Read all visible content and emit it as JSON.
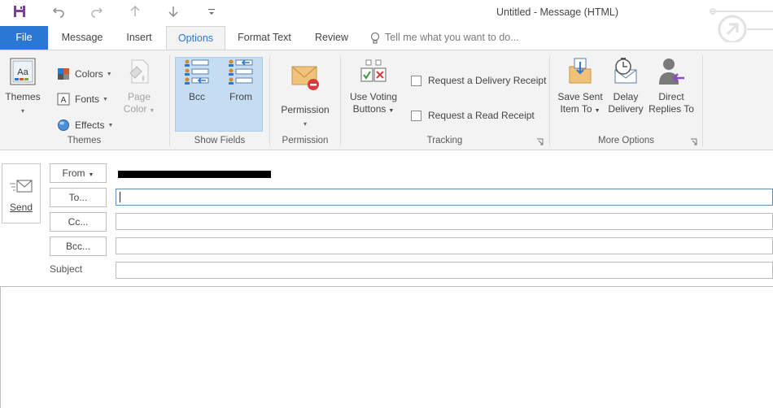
{
  "window": {
    "title": "Untitled - Message (HTML)"
  },
  "quick_access": [
    {
      "name": "save-icon"
    },
    {
      "name": "undo-icon"
    },
    {
      "name": "redo-icon"
    },
    {
      "name": "previous-item-icon"
    },
    {
      "name": "next-item-icon"
    },
    {
      "name": "customize-qat-icon"
    }
  ],
  "tabs": {
    "file": "File",
    "message": "Message",
    "insert": "Insert",
    "options": "Options",
    "format_text": "Format Text",
    "review": "Review",
    "tell_me": "Tell me what you want to do..."
  },
  "ribbon": {
    "themes_group": {
      "label": "Themes",
      "themes": "Themes",
      "colors": "Colors",
      "fonts": "Fonts",
      "effects": "Effects",
      "page_color_line1": "Page",
      "page_color_line2": "Color"
    },
    "show_fields": {
      "label": "Show Fields",
      "bcc": "Bcc",
      "from": "From"
    },
    "permission": {
      "label": "Permission",
      "button": "Permission"
    },
    "tracking": {
      "label": "Tracking",
      "voting_line1": "Use Voting",
      "voting_line2": "Buttons",
      "delivery_receipt": "Request a Delivery Receipt",
      "read_receipt": "Request a Read Receipt"
    },
    "more_options": {
      "label": "More Options",
      "save_sent_line1": "Save Sent",
      "save_sent_line2": "Item To",
      "delay_line1": "Delay",
      "delay_line2": "Delivery",
      "direct_line1": "Direct",
      "direct_line2": "Replies To"
    }
  },
  "compose": {
    "send": "Send",
    "from": "From",
    "to": "To...",
    "cc": "Cc...",
    "bcc": "Bcc...",
    "subject": "Subject",
    "to_value": "",
    "cc_value": "",
    "bcc_value": "",
    "subject_value": ""
  },
  "colors": {
    "accent": "#2b78d4",
    "ribbon_bg": "#f3f3f3",
    "selected": "#c5ddf3"
  }
}
